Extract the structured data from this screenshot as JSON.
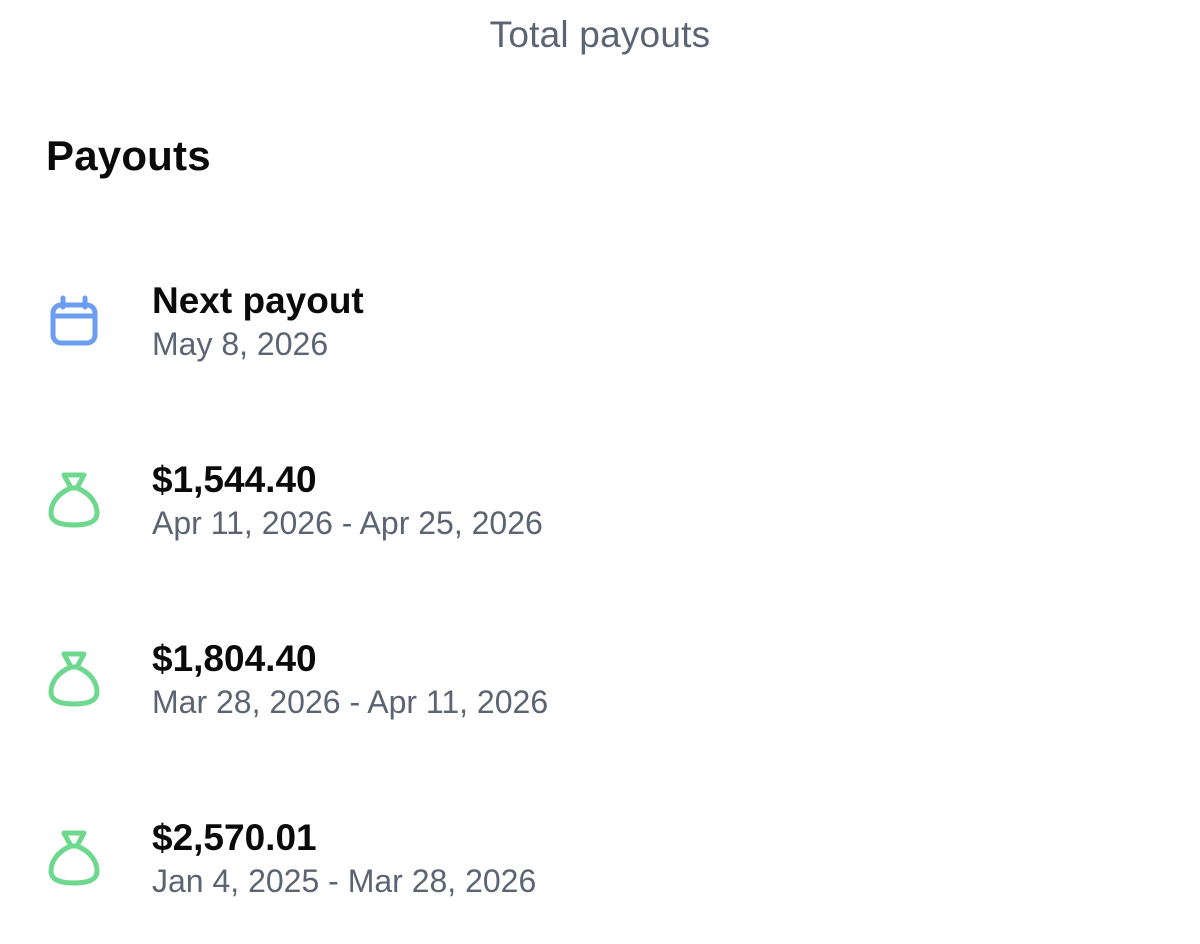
{
  "header": {
    "total_payouts_label": "Total payouts"
  },
  "section": {
    "title": "Payouts"
  },
  "next_payout": {
    "label": "Next payout",
    "date": "May 8, 2026",
    "icon": "calendar-icon",
    "icon_color": "#6b9ef0"
  },
  "payouts": [
    {
      "amount": "$1,544.40",
      "period": "Apr 11, 2026 - Apr 25, 2026",
      "icon": "money-bag-icon"
    },
    {
      "amount": "$1,804.40",
      "period": "Mar 28, 2026 - Apr 11, 2026",
      "icon": "money-bag-icon"
    },
    {
      "amount": "$2,570.01",
      "period": "Jan 4, 2025 - Mar 28, 2026",
      "icon": "money-bag-icon"
    }
  ],
  "colors": {
    "money_bag": "#6fd88f",
    "secondary_text": "#5b6472",
    "primary_text": "#0a0a0a"
  }
}
